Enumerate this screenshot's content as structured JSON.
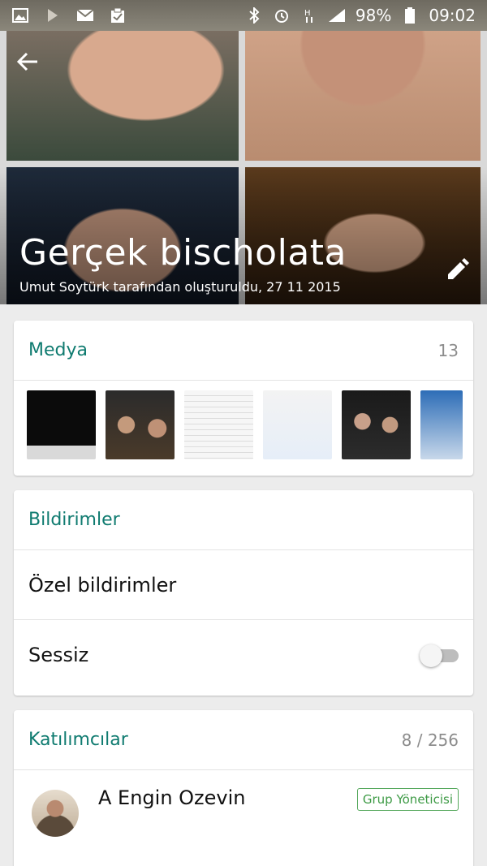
{
  "status_bar": {
    "left_icons": [
      "image-icon",
      "play-icon",
      "mail-icon",
      "clipboard-icon"
    ],
    "right_icons": [
      "bluetooth-icon",
      "alarm-icon",
      "data-icon",
      "signal-icon"
    ],
    "battery": "98%",
    "time": "09:02"
  },
  "header": {
    "title": "Gerçek bischolata",
    "subtitle": "Umut Soytürk tarafından oluşturuldu, 27 11 2015"
  },
  "media": {
    "title": "Medya",
    "count": "13"
  },
  "notifications": {
    "title": "Bildirimler",
    "custom_label": "Özel bildirimler",
    "mute_label": "Sessiz",
    "mute_enabled": false
  },
  "participants": {
    "title": "Katılımcılar",
    "count": "8 / 256",
    "items": [
      {
        "name": "A Engin Ozevin",
        "badge": "Grup Yöneticisi"
      }
    ]
  },
  "colors": {
    "accent": "#0f7b70",
    "admin_badge": "#3d9a45"
  }
}
